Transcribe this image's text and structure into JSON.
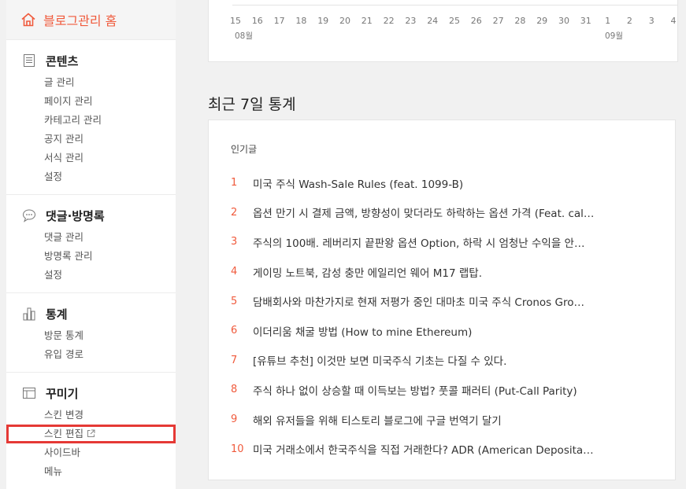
{
  "sidebar": {
    "home_label": "블로그관리 홈",
    "sections": [
      {
        "title": "콘텐츠",
        "icon": "document-icon",
        "items": [
          "글 관리",
          "페이지 관리",
          "카테고리 관리",
          "공지 관리",
          "서식 관리",
          "설정"
        ]
      },
      {
        "title": "댓글·방명록",
        "icon": "speech-bubble-icon",
        "items": [
          "댓글 관리",
          "방명록 관리",
          "설정"
        ]
      },
      {
        "title": "통계",
        "icon": "bar-chart-icon",
        "items": [
          "방문 통계",
          "유입 경로"
        ]
      },
      {
        "title": "꾸미기",
        "icon": "layout-icon",
        "items": [
          "스킨 변경",
          "스킨 편집",
          "사이드바",
          "메뉴"
        ]
      }
    ]
  },
  "chart": {
    "ticks": [
      "15",
      "16",
      "17",
      "18",
      "19",
      "20",
      "21",
      "22",
      "23",
      "24",
      "25",
      "26",
      "27",
      "28",
      "29",
      "30",
      "31",
      "1",
      "2",
      "3",
      "4"
    ],
    "month_start": "08월",
    "month_next": "09월"
  },
  "stats": {
    "title": "최근 7일 통계",
    "popular_label": "인기글",
    "posts": [
      {
        "rank": "1",
        "title": "미국 주식 Wash-Sale Rules (feat. 1099-B)"
      },
      {
        "rank": "2",
        "title": "옵션 만기 시 결제 금액, 방향성이 맞더라도 하락하는 옵션 가격 (Feat. cal…"
      },
      {
        "rank": "3",
        "title": "주식의 100배. 레버리지 끝판왕 옵션 Option, 하락 시 엄청난 수익을 안…"
      },
      {
        "rank": "4",
        "title": "게이밍 노트북, 감성 충만 에일리언 웨어 M17 랩탑."
      },
      {
        "rank": "5",
        "title": "담배회사와 마찬가지로 현재 저평가 중인 대마초 미국 주식 Cronos Gro…"
      },
      {
        "rank": "6",
        "title": "이더리움 채굴 방법 (How to mine Ethereum)"
      },
      {
        "rank": "7",
        "title": "[유튜브 추천] 이것만 보면 미국주식 기초는 다질 수 있다."
      },
      {
        "rank": "8",
        "title": "주식 하나 없이 상승할 때 이득보는 방법? 풋콜 패러티 (Put-Call Parity)"
      },
      {
        "rank": "9",
        "title": "해외 유저들을 위해 티스토리 블로그에 구글 번역기 달기"
      },
      {
        "rank": "10",
        "title": "미국 거래소에서 한국주식을 직접 거래한다? ADR (American Deposita…"
      }
    ]
  },
  "colors": {
    "accent": "#f05a3c",
    "highlight": "#e53935"
  }
}
